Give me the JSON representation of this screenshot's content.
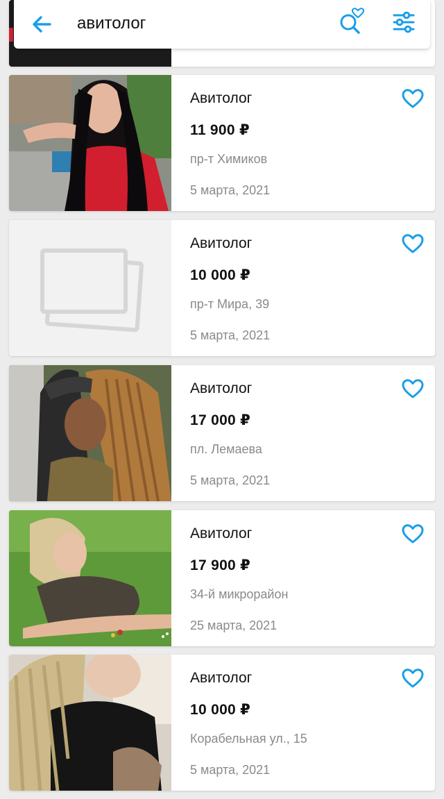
{
  "colors": {
    "accent": "#1a9ee8",
    "text": "#111111",
    "muted": "#8a8a8a"
  },
  "search": {
    "query": "авитолог",
    "back_icon": "arrow-left-icon",
    "saved_search_icon": "search-heart-icon",
    "filters_icon": "sliders-icon"
  },
  "listings": [
    {
      "title": "Авитолог",
      "price": "11 900 ₽",
      "address": "пр-т Химиков",
      "date": "5 марта, 2021",
      "photo": "photo"
    },
    {
      "title": "Авитолог",
      "price": "10 000 ₽",
      "address": "пр-т Мира, 39",
      "date": "5 марта, 2021",
      "photo": "no-photo-placeholder"
    },
    {
      "title": "Авитолог",
      "price": "17 000 ₽",
      "address": "пл. Лемаева",
      "date": "5 марта, 2021",
      "photo": "photo"
    },
    {
      "title": "Авитолог",
      "price": "17 900 ₽",
      "address": "34-й микрорайон",
      "date": "25 марта, 2021",
      "photo": "photo"
    },
    {
      "title": "Авитолог",
      "price": "10 000 ₽",
      "address": "Корабельная ул., 15",
      "date": "5 марта, 2021",
      "photo": "photo"
    }
  ]
}
